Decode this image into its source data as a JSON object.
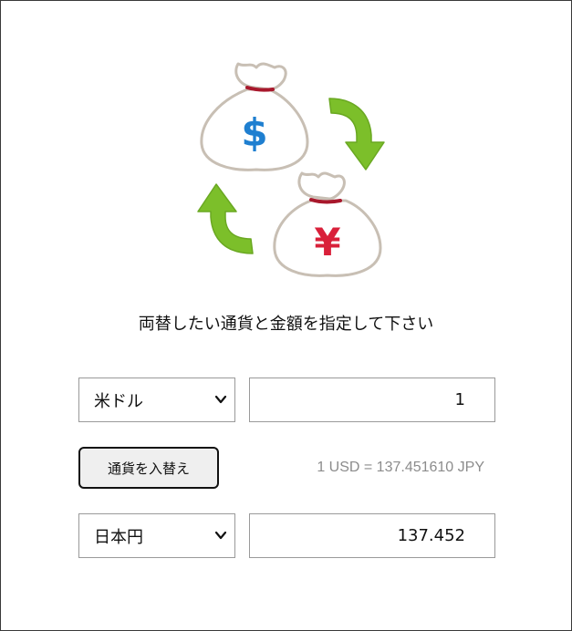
{
  "illustration": {
    "dollar_symbol": "$",
    "yen_symbol": "¥",
    "arrow_color": "#7cbf2a",
    "dollar_color": "#1f7fd0",
    "yen_color": "#d9203a"
  },
  "instruction_text": "両替したい通貨と金額を指定して下さい",
  "from": {
    "currency": "米ドル",
    "amount": "1"
  },
  "swap_button_label": "通貨を入替え",
  "rate_text": "1 USD = 137.451610 JPY",
  "to": {
    "currency": "日本円",
    "amount": "137.452"
  }
}
